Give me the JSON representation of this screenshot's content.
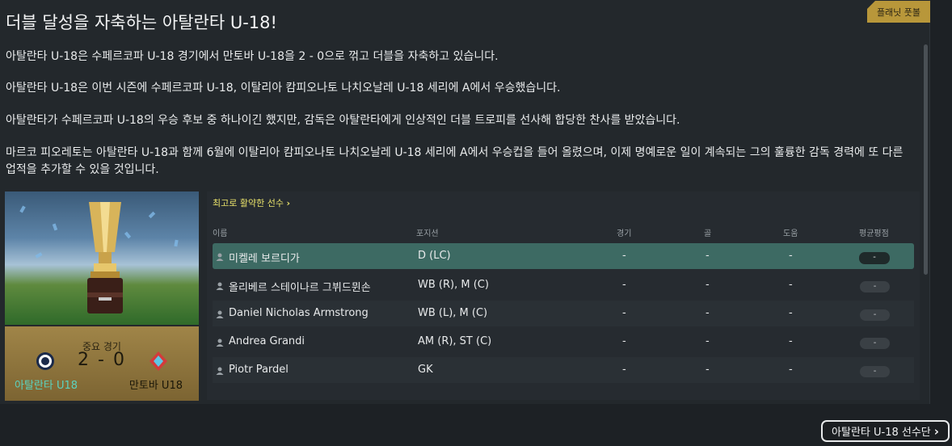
{
  "headline": "더블 달성을 자축하는 아탈란타 U-18!",
  "tag": "플래닛 풋볼",
  "paragraphs": [
    "아탈란타 U-18은 수페르코파 U-18 경기에서 만토바 U-18을 2 - 0으로 꺾고 더블을 자축하고 있습니다.",
    "아탈란타 U-18은 이번 시즌에 수페르코파 U-18, 이탈리아 캄피오나토 나치오날레 U-18 세리에 A에서 우승했습니다.",
    "아탈란타가 수페르코파 U-18의 우승 후보 중 하나이긴 했지만,  감독은 아탈란타에게 인상적인 더블 트로피를 선사해 합당한 찬사를 받았습니다.",
    "마르코 피오레토는 아탈란타 U-18과 함께 6월에 이탈리아 캄피오나토 나치오날레 U-18 세리에 A에서 우승컵을 들어 올렸으며, 이제 명예로운 일이 계속되는 그의 훌륭한 감독 경력에 또 다른 업적을 추가할 수 있을 것입니다."
  ],
  "match": {
    "label": "중요 경기",
    "score": "2 - 0",
    "home": "아탈란타 U18",
    "away": "만토바 U18"
  },
  "players": {
    "title": "최고로 활약한 선수",
    "title_arrow": "›",
    "columns": {
      "name": "이름",
      "position": "포지션",
      "apps": "경기",
      "goals": "골",
      "assists": "도움",
      "rating": "평균평점"
    },
    "rows": [
      {
        "name": "미켈레 보르디가",
        "position": "D (LC)",
        "apps": "-",
        "goals": "-",
        "assists": "-",
        "rating": "-"
      },
      {
        "name": "올리베르 스테이나르 그뷔드뮌손",
        "position": "WB (R), M (C)",
        "apps": "-",
        "goals": "-",
        "assists": "-",
        "rating": "-"
      },
      {
        "name": "Daniel Nicholas Armstrong",
        "position": "WB (L), M (C)",
        "apps": "-",
        "goals": "-",
        "assists": "-",
        "rating": "-"
      },
      {
        "name": "Andrea Grandi",
        "position": "AM (R), ST (C)",
        "apps": "-",
        "goals": "-",
        "assists": "-",
        "rating": "-"
      },
      {
        "name": "Piotr Pardel",
        "position": "GK",
        "apps": "-",
        "goals": "-",
        "assists": "-",
        "rating": "-"
      }
    ]
  },
  "squad_button": {
    "label": "아탈란타 U-18 선수단",
    "arrow": "›"
  },
  "colors": {
    "accent_gold": "#b8973a",
    "selected_row": "#3d6a63",
    "highlight_yellow": "#e9e26a"
  },
  "icons": [
    "person-icon",
    "chevron-right-icon",
    "trophy-image",
    "crest-icon"
  ]
}
